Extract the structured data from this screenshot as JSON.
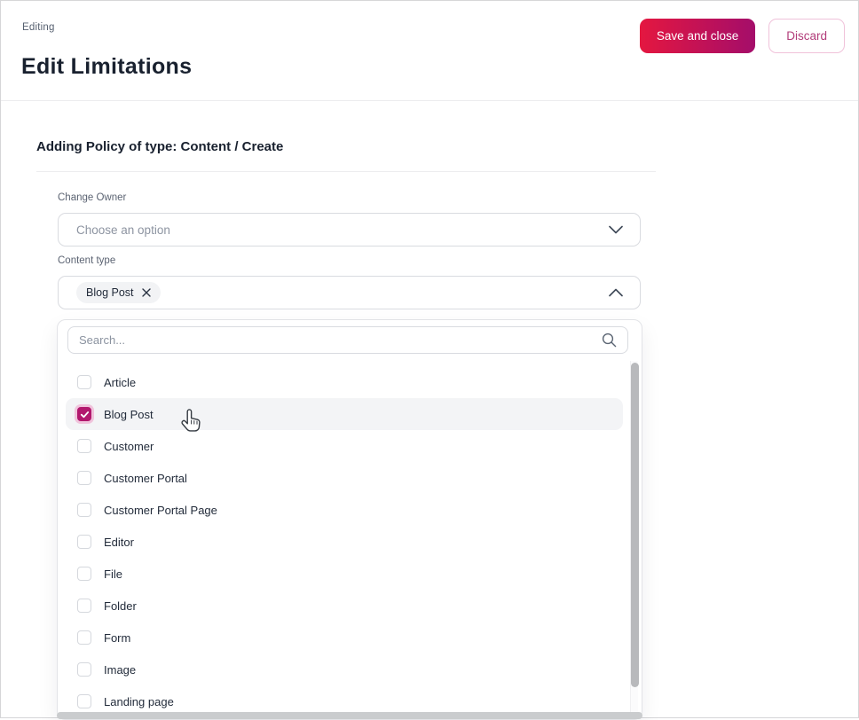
{
  "header": {
    "eyebrow": "Editing",
    "title": "Edit Limitations",
    "save_button": "Save and close",
    "discard_button": "Discard"
  },
  "form": {
    "section_title": "Adding Policy of type: Content / Create",
    "change_owner": {
      "label": "Change Owner",
      "placeholder": "Choose an option"
    },
    "content_type": {
      "label": "Content type",
      "selected_chip": "Blog Post"
    }
  },
  "dropdown": {
    "search_placeholder": "Search...",
    "options": [
      {
        "label": "Article",
        "checked": false,
        "highlighted": false
      },
      {
        "label": "Blog Post",
        "checked": true,
        "highlighted": true
      },
      {
        "label": "Customer",
        "checked": false,
        "highlighted": false
      },
      {
        "label": "Customer Portal",
        "checked": false,
        "highlighted": false
      },
      {
        "label": "Customer Portal Page",
        "checked": false,
        "highlighted": false
      },
      {
        "label": "Editor",
        "checked": false,
        "highlighted": false
      },
      {
        "label": "File",
        "checked": false,
        "highlighted": false
      },
      {
        "label": "Folder",
        "checked": false,
        "highlighted": false
      },
      {
        "label": "Form",
        "checked": false,
        "highlighted": false
      },
      {
        "label": "Image",
        "checked": false,
        "highlighted": false
      },
      {
        "label": "Landing page",
        "checked": false,
        "highlighted": false
      }
    ]
  },
  "colors": {
    "accent_gradient_start": "#e41740",
    "accent_gradient_end": "#a40d6a",
    "checkbox_checked": "#b2186e",
    "checkbox_halo": "#f0c4dc",
    "discard_text": "#b23d7a",
    "discard_border": "#f0c2da",
    "row_highlight": "#f3f4f6"
  }
}
